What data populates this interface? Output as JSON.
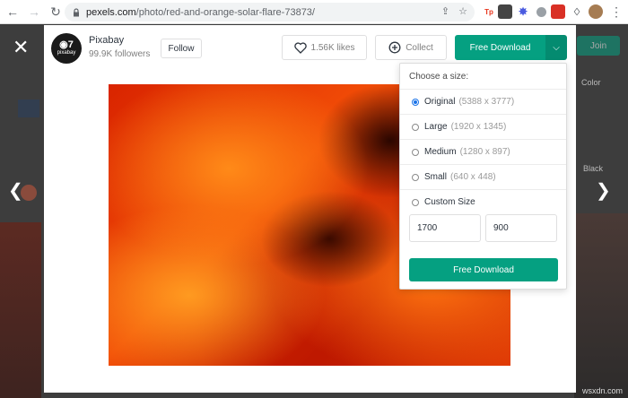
{
  "browser": {
    "url_host": "pexels.com",
    "url_path": "/photo/red-and-orange-solar-flare-73873/"
  },
  "author": {
    "name": "Pixabay",
    "followers": "99.9K followers",
    "logo_text": "pixabay"
  },
  "toolbar": {
    "follow_label": "Follow",
    "likes_label": "1.56K likes",
    "collect_label": "Collect",
    "download_label": "Free Download"
  },
  "dropdown": {
    "title": "Choose a size:",
    "options": [
      {
        "label": "Original",
        "dims": "(5388 x 3777)",
        "selected": true
      },
      {
        "label": "Large",
        "dims": "(1920 x 1345)",
        "selected": false
      },
      {
        "label": "Medium",
        "dims": "(1280 x 897)",
        "selected": false
      },
      {
        "label": "Small",
        "dims": "(640 x 448)",
        "selected": false
      },
      {
        "label": "Custom Size",
        "dims": "",
        "selected": false
      }
    ],
    "custom_width": "1700",
    "custom_height": "900",
    "download_label": "Free Download"
  },
  "backdrop": {
    "join_label": "Join",
    "color_label": "Color",
    "black_label": "Black"
  },
  "watermark": "wsxdn.com",
  "colors": {
    "accent": "#05a081",
    "accent_dark": "#048b70"
  }
}
